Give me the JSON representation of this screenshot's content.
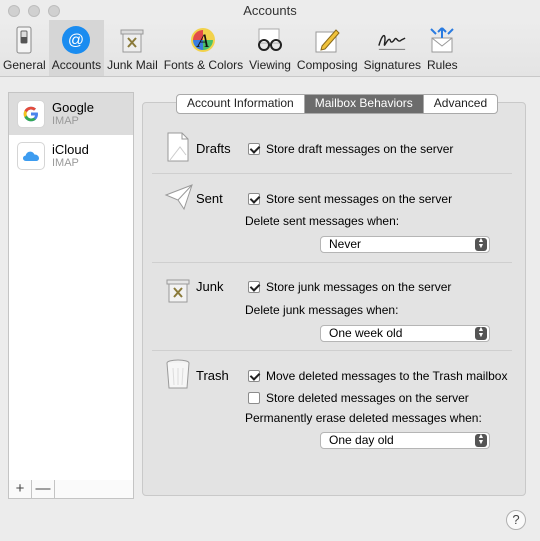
{
  "window": {
    "title": "Accounts"
  },
  "toolbar": {
    "items": [
      {
        "label": "General"
      },
      {
        "label": "Accounts"
      },
      {
        "label": "Junk Mail"
      },
      {
        "label": "Fonts & Colors"
      },
      {
        "label": "Viewing"
      },
      {
        "label": "Composing"
      },
      {
        "label": "Signatures"
      },
      {
        "label": "Rules"
      }
    ],
    "active": "Accounts",
    "accent": "#1a8cf0"
  },
  "sidebar": {
    "accounts": [
      {
        "name": "Google",
        "type": "IMAP"
      },
      {
        "name": "iCloud",
        "type": "IMAP"
      }
    ],
    "add_label": "+",
    "remove_label": "—"
  },
  "tabs": [
    {
      "label": "Account Information"
    },
    {
      "label": "Mailbox Behaviors"
    },
    {
      "label": "Advanced"
    }
  ],
  "sections": {
    "drafts": {
      "title": "Drafts",
      "store_label": "Store draft messages on the server",
      "store_checked": true
    },
    "sent": {
      "title": "Sent",
      "store_label": "Store sent messages on the server",
      "store_checked": true,
      "delete_label": "Delete sent messages when:",
      "delete_value": "Never"
    },
    "junk": {
      "title": "Junk",
      "store_label": "Store junk messages on the server",
      "store_checked": true,
      "delete_label": "Delete junk messages when:",
      "delete_value": "One week old"
    },
    "trash": {
      "title": "Trash",
      "move_label": "Move deleted messages to the Trash mailbox",
      "move_checked": true,
      "store_label": "Store deleted messages on the server",
      "store_checked": false,
      "erase_label": "Permanently erase deleted messages when:",
      "erase_value": "One day old"
    }
  },
  "help_label": "?"
}
